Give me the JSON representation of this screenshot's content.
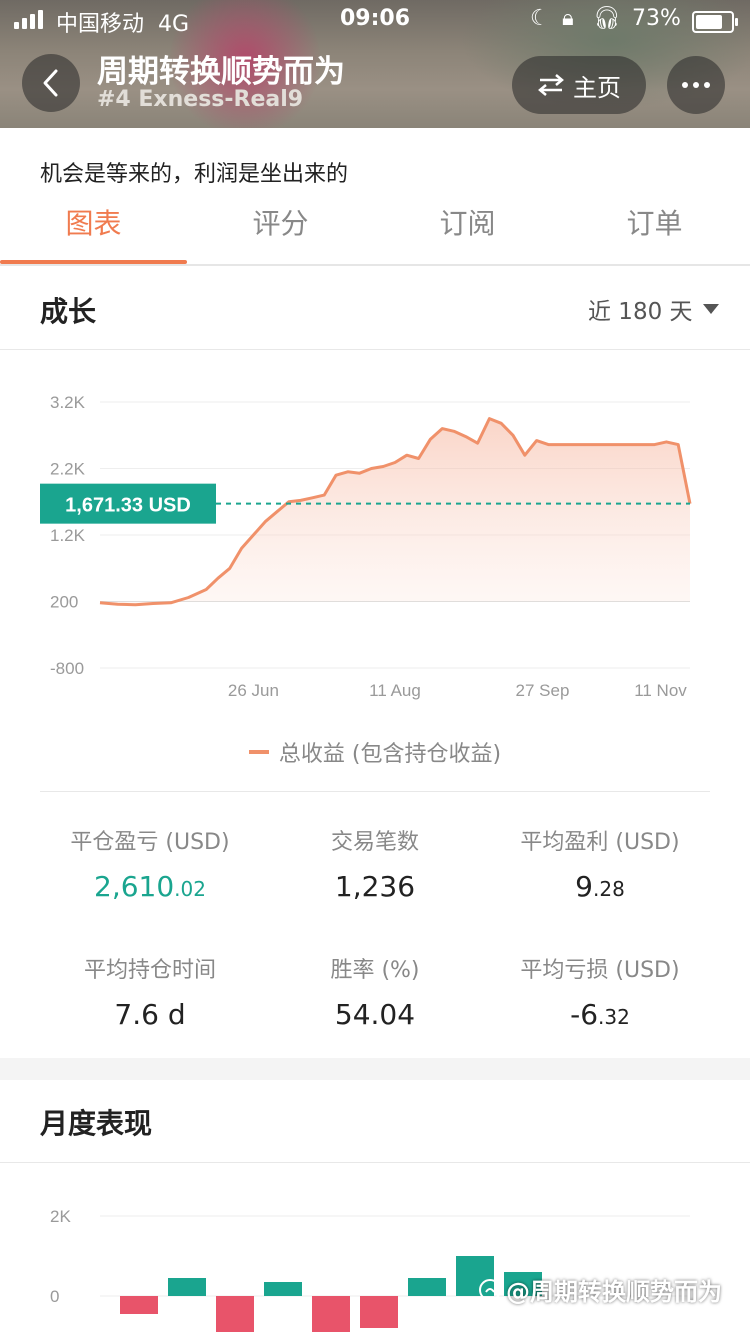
{
  "status_bar": {
    "carrier": "中国移动",
    "network": "4G",
    "time": "09:06",
    "battery": "73%"
  },
  "header": {
    "title": "周期转换顺势而为",
    "subtitle": "#4 Exness-Real9",
    "home_label": "主页"
  },
  "motto": "机会是等来的，利润是坐出来的",
  "tabs": [
    {
      "label": "图表",
      "active": true
    },
    {
      "label": "评分",
      "active": false
    },
    {
      "label": "订阅",
      "active": false
    },
    {
      "label": "订单",
      "active": false
    }
  ],
  "growth": {
    "title": "成长",
    "range": "近 180 天",
    "current_value_label": "1,671.33 USD",
    "current_value": 1671.33,
    "legend": "总收益 (包含持仓收益)"
  },
  "chart_data": [
    {
      "type": "area",
      "title": "",
      "yticks": [
        "3.2K",
        "2.2K",
        "1.2K",
        "200",
        "-800"
      ],
      "ytick_values": [
        3200,
        2200,
        1200,
        200,
        -800
      ],
      "xticks": [
        "26 Jun",
        "11 Aug",
        "27 Sep",
        "11 Nov"
      ],
      "ylim": [
        -800,
        3200
      ],
      "series": [
        {
          "name": "总收益 (包含持仓收益)",
          "color": "#f0916a",
          "x": [
            0,
            3,
            6,
            9,
            12,
            15,
            18,
            20,
            22,
            24,
            26,
            28,
            30,
            32,
            34,
            36,
            38,
            40,
            42,
            44,
            46,
            48,
            50,
            52,
            54,
            56,
            58,
            60,
            62,
            64,
            66,
            68,
            70,
            72,
            74,
            76,
            78,
            80,
            82,
            84,
            86,
            88,
            90,
            92,
            94,
            96,
            98,
            100
          ],
          "y": [
            180,
            160,
            150,
            170,
            180,
            260,
            380,
            550,
            700,
            1000,
            1200,
            1400,
            1550,
            1700,
            1720,
            1760,
            1800,
            2100,
            2150,
            2130,
            2200,
            2230,
            2290,
            2400,
            2350,
            2640,
            2800,
            2760,
            2680,
            2580,
            2950,
            2880,
            2700,
            2400,
            2620,
            2560,
            2560,
            2560,
            2560,
            2560,
            2560,
            2560,
            2560,
            2560,
            2560,
            2600,
            2560,
            1671
          ]
        }
      ]
    },
    {
      "type": "bar",
      "title": "月度表现",
      "yticks": [
        "2K",
        "0"
      ],
      "ylim": [
        -1000,
        2000
      ],
      "values": [
        -450,
        450,
        -900,
        350,
        -900,
        -800,
        450,
        1000,
        600
      ]
    }
  ],
  "stats": [
    {
      "label": "平仓盈亏 (USD)",
      "int": "2,610",
      "dec": ".02",
      "highlight": true
    },
    {
      "label": "交易笔数",
      "int": "1,236",
      "dec": "",
      "highlight": false
    },
    {
      "label": "平均盈利 (USD)",
      "int": "9",
      "dec": ".28",
      "highlight": false
    },
    {
      "label": "平均持仓时间",
      "int": "7.6 d",
      "dec": "",
      "highlight": false
    },
    {
      "label": "胜率 (%)",
      "int": "54.04",
      "dec": "",
      "highlight": false
    },
    {
      "label": "平均亏损 (USD)",
      "int": "-6",
      "dec": ".32",
      "highlight": false
    }
  ],
  "monthly": {
    "title": "月度表现"
  },
  "watermark": "@周期转换顺势而为",
  "colors": {
    "accent": "#f07b4f",
    "green": "#1aa58f",
    "red": "#e8546a",
    "teal": "#1aa58f"
  },
  "icons": {
    "back": "chevron-left-icon",
    "swap": "swap-arrows-icon",
    "more": "more-dots-icon",
    "dropdown": "caret-down-icon"
  }
}
